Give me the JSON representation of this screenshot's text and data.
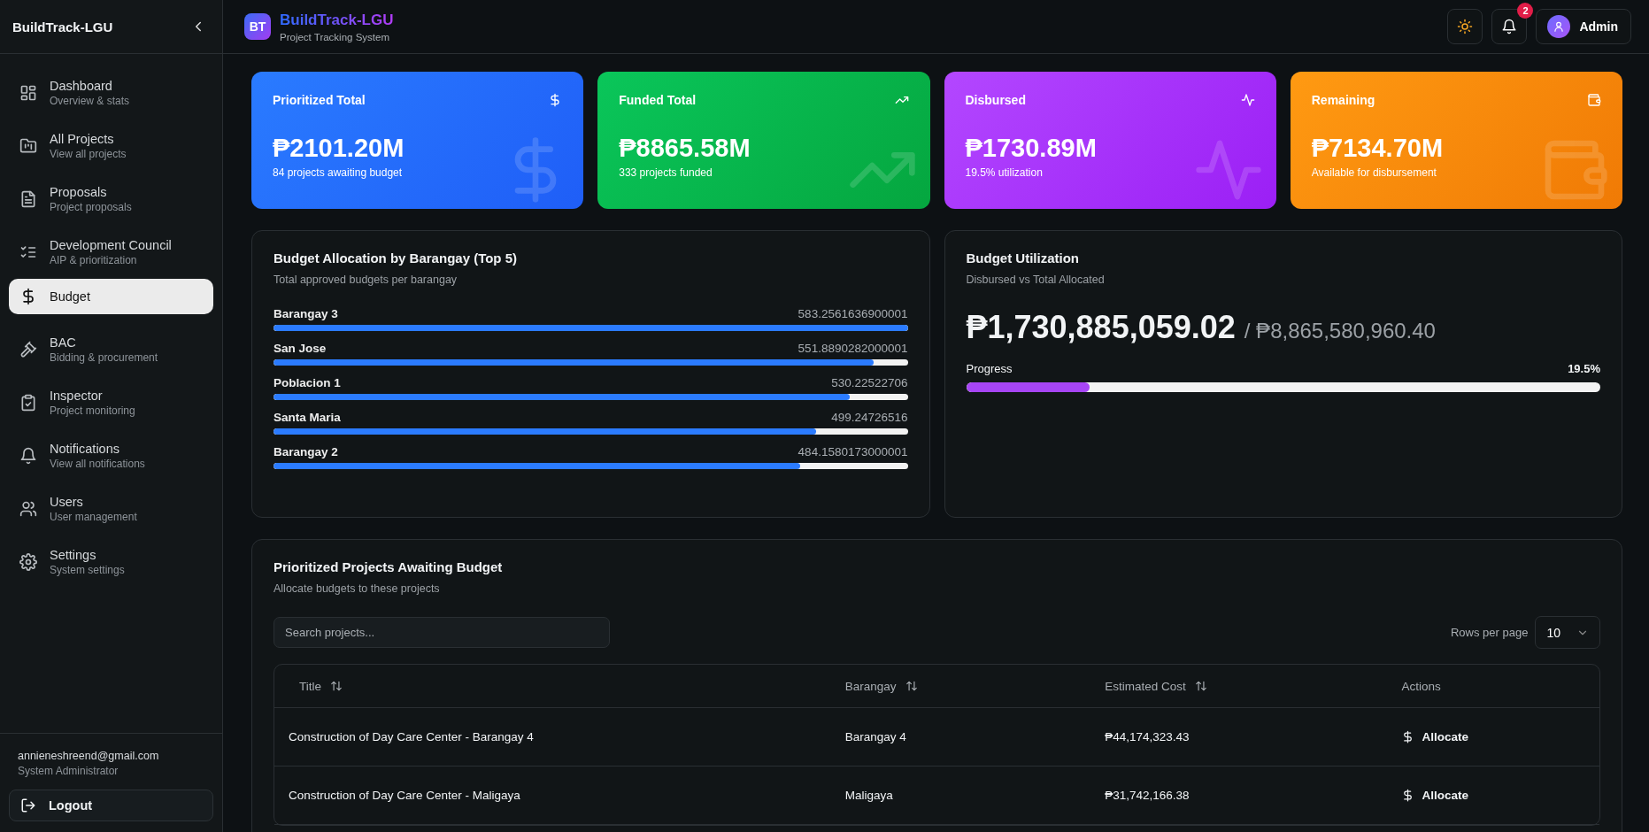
{
  "sidebar": {
    "brand": "BuildTrack-LGU",
    "items": [
      {
        "label": "Dashboard",
        "sub": "Overview & stats",
        "selected": false
      },
      {
        "label": "All Projects",
        "sub": "View all projects",
        "selected": false
      },
      {
        "label": "Proposals",
        "sub": "Project proposals",
        "selected": false
      },
      {
        "label": "Development Council",
        "sub": "AIP & prioritization",
        "selected": false
      },
      {
        "label": "Budget",
        "selected": true
      },
      {
        "label": "BAC",
        "sub": "Bidding & procurement",
        "selected": false
      },
      {
        "label": "Inspector",
        "sub": "Project monitoring",
        "selected": false
      },
      {
        "label": "Notifications",
        "sub": "View all notifications",
        "selected": false
      },
      {
        "label": "Users",
        "sub": "User management",
        "selected": false
      },
      {
        "label": "Settings",
        "sub": "System settings",
        "selected": false
      }
    ],
    "user": {
      "email": "annieneshreend@gmail.com",
      "role": "System Administrator"
    },
    "logout": "Logout"
  },
  "header": {
    "logo": "BT",
    "title": "BuildTrack-LGU",
    "subtitle": "Project Tracking System",
    "notification_count": "2",
    "user": "Admin"
  },
  "stat_cards": [
    {
      "title": "Prioritized Total",
      "value": "₱2101.20M",
      "note": "84 projects awaiting budget"
    },
    {
      "title": "Funded Total",
      "value": "₱8865.58M",
      "note": "333 projects funded"
    },
    {
      "title": "Disbursed",
      "value": "₱1730.89M",
      "note": "19.5% utilization"
    },
    {
      "title": "Remaining",
      "value": "₱7134.70M",
      "note": "Available for disbursement"
    }
  ],
  "allocation": {
    "title": "Budget Allocation by Barangay (Top 5)",
    "subtitle": "Total approved budgets per barangay",
    "rows": [
      {
        "name": "Barangay 3",
        "amount": "583.2561636900001",
        "level": 1.0
      },
      {
        "name": "San Jose",
        "amount": "551.8890282000001",
        "level": 0.946
      },
      {
        "name": "Poblacion 1",
        "amount": "530.22522706",
        "level": 0.909
      },
      {
        "name": "Santa Maria",
        "amount": "499.24726516",
        "level": 0.856
      },
      {
        "name": "Barangay 2",
        "amount": "484.1580173000001",
        "level": 0.83
      }
    ]
  },
  "utilization": {
    "title": "Budget Utilization",
    "subtitle": "Disbursed vs Total Allocated",
    "disbursed": "₱1,730,885,059.02",
    "total": "/ ₱8,865,580,960.40",
    "progress_label": "Progress",
    "percent": "19.5%",
    "level": 0.195
  },
  "projects": {
    "title": "Prioritized Projects Awaiting Budget",
    "subtitle": "Allocate budgets to these projects",
    "search": {
      "placeholder": "Search projects..."
    },
    "rows_per_page_label": "Rows per page",
    "rows_per_page": "10",
    "columns": [
      {
        "label": "Title",
        "sortable": true
      },
      {
        "label": "Barangay",
        "sortable": true
      },
      {
        "label": "Estimated Cost",
        "sortable": true
      },
      {
        "label": "Actions",
        "sortable": false
      }
    ],
    "rows": [
      {
        "title": "Construction of Day Care Center - Barangay 4",
        "barangay": "Barangay 4",
        "cost": "₱44,174,323.43",
        "action": "Allocate"
      },
      {
        "title": "Construction of Day Care Center - Maligaya",
        "barangay": "Maligaya",
        "cost": "₱31,742,166.38",
        "action": "Allocate"
      }
    ]
  }
}
